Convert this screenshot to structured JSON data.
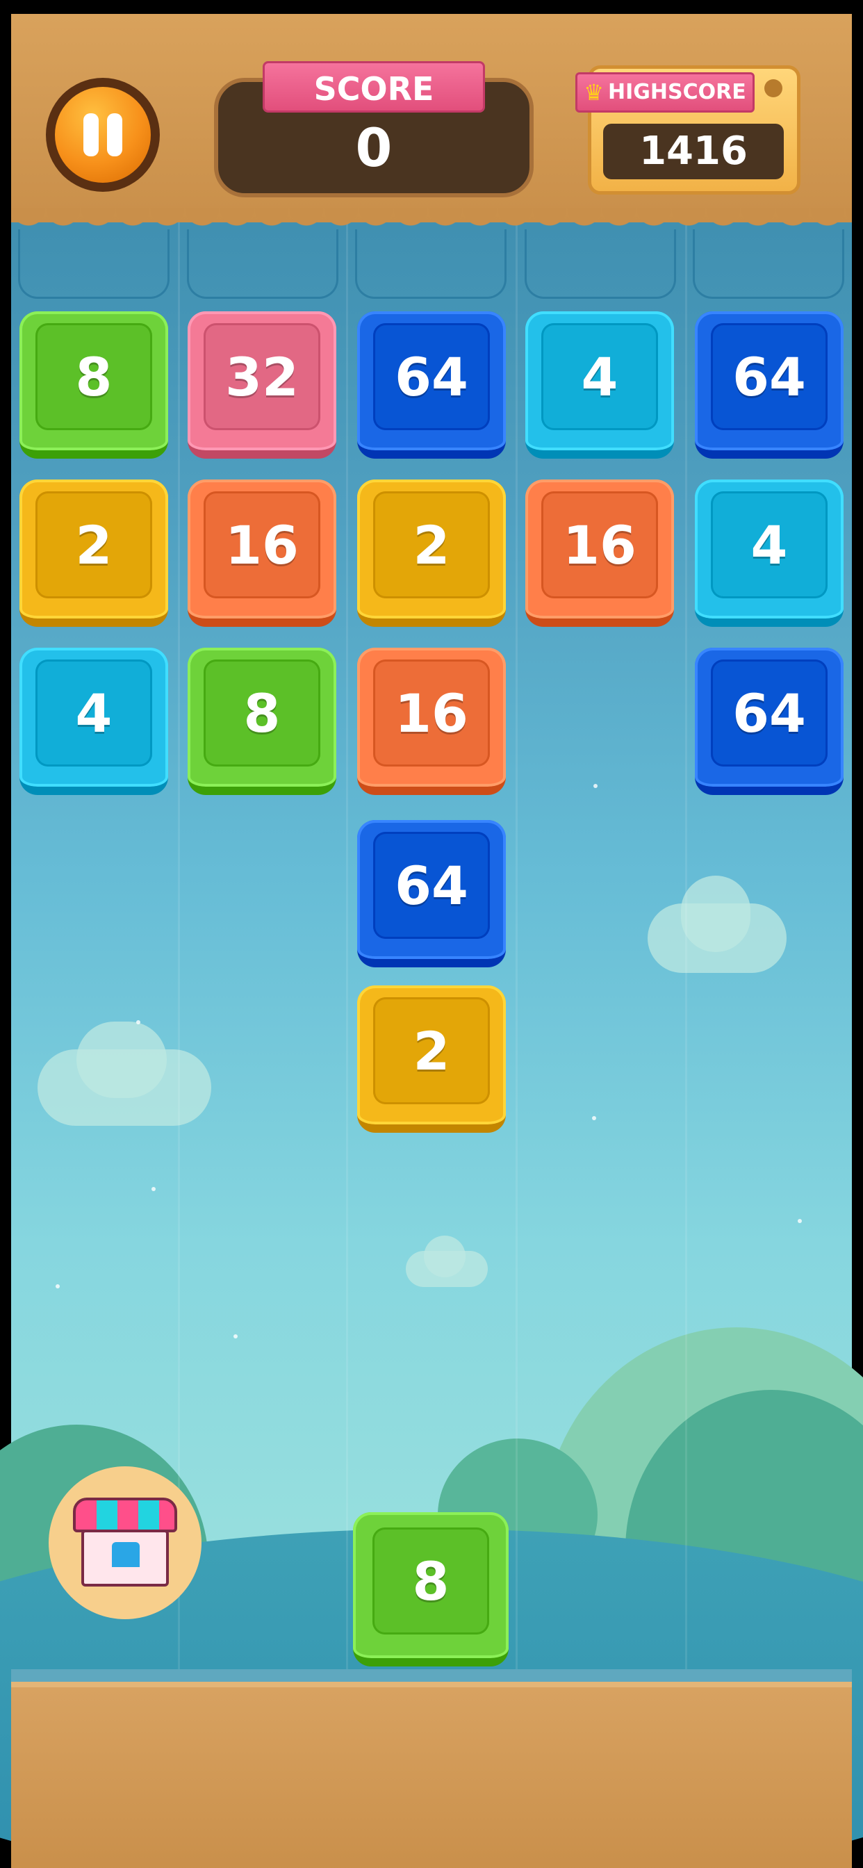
{
  "header": {
    "score_label": "SCORE",
    "score_value": "0",
    "highscore_label": "HIGHSCORE",
    "highscore_value": "1416"
  },
  "icons": {
    "pause": "pause-icon",
    "crown": "crown-icon",
    "shop": "shop-icon"
  },
  "colors": {
    "2": "#f5b81a",
    "4": "#23c0ea",
    "8": "#6ed23a",
    "16": "#ff7f4a",
    "32": "#f47a96",
    "64": "#1a67e6"
  },
  "board": {
    "columns": [
      [
        "8",
        "2",
        "4"
      ],
      [
        "32",
        "16",
        "8"
      ],
      [
        "64",
        "2",
        "16",
        "64",
        "2"
      ],
      [
        "4",
        "16"
      ],
      [
        "64",
        "4",
        "64"
      ]
    ]
  },
  "next_tile": {
    "value": "8",
    "column": 3
  }
}
